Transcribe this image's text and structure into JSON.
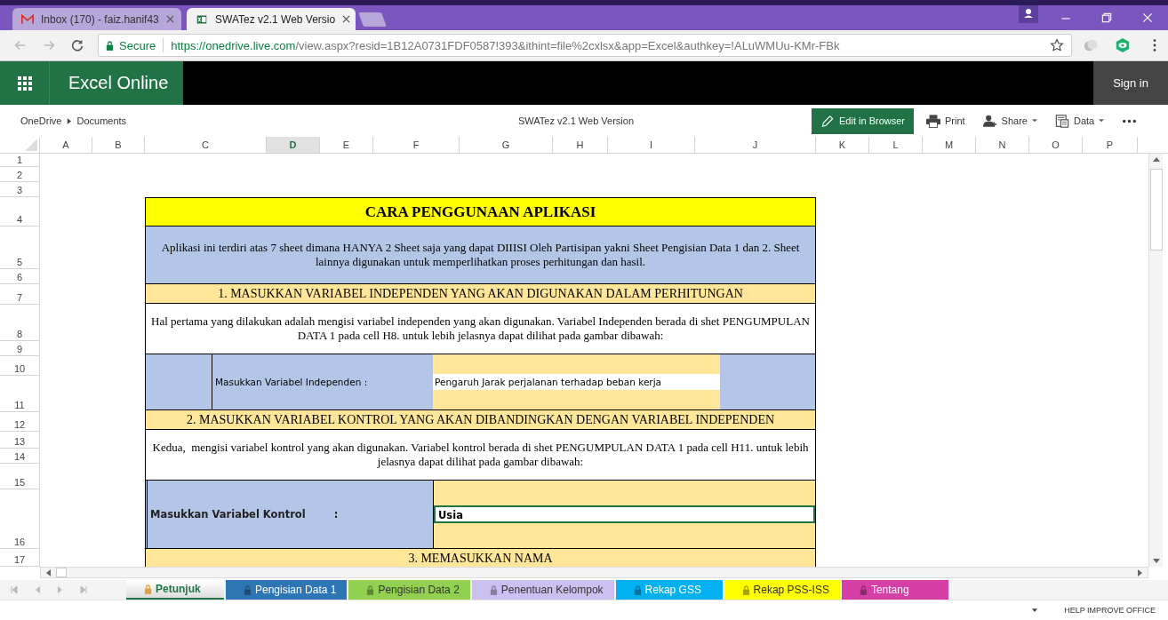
{
  "browser": {
    "tabs": [
      {
        "title": "Inbox (170) - faiz.hanif43",
        "selected": false
      },
      {
        "title": "SWATez v2.1 Web Versio",
        "selected": true
      }
    ],
    "address": {
      "secure_label": "Secure",
      "url_host": "https://onedrive.live.com",
      "url_path": "/view.aspx?resid=1B12A0731FDF0587!393&ithint=file%2cxlsx&app=Excel&authkey=!ALuWMUu-KMr-FBk"
    }
  },
  "app_bar": {
    "app_name": "Excel Online",
    "sign_in": "Sign in"
  },
  "toolbar": {
    "breadcrumb": [
      "OneDrive",
      "Documents"
    ],
    "doc_title": "SWATez v2.1 Web Version",
    "actions": [
      {
        "label": "Edit in Browser",
        "kind": "edit",
        "dropdown": false
      },
      {
        "label": "Print",
        "kind": "print",
        "dropdown": false
      },
      {
        "label": "Share",
        "kind": "share",
        "dropdown": true
      },
      {
        "label": "Data",
        "kind": "data",
        "dropdown": true
      }
    ]
  },
  "columns": [
    {
      "label": "A",
      "selected": false
    },
    {
      "label": "B",
      "selected": false
    },
    {
      "label": "C",
      "selected": false
    },
    {
      "label": "D",
      "selected": true
    },
    {
      "label": "E",
      "selected": false
    },
    {
      "label": "F",
      "selected": false
    },
    {
      "label": "G",
      "selected": false
    },
    {
      "label": "H",
      "selected": false
    },
    {
      "label": "I",
      "selected": false
    },
    {
      "label": "J",
      "selected": false
    },
    {
      "label": "K",
      "selected": false
    },
    {
      "label": "L",
      "selected": false
    },
    {
      "label": "M",
      "selected": false
    },
    {
      "label": "N",
      "selected": false
    },
    {
      "label": "O",
      "selected": false
    },
    {
      "label": "P",
      "selected": false
    }
  ],
  "rows": [
    "1",
    "2",
    "3",
    "4",
    "5",
    "6",
    "7",
    "8",
    "9",
    "10",
    "11",
    "12",
    "13",
    "14",
    "15",
    "16",
    "17"
  ],
  "sheet": {
    "blocks": [
      {
        "kind": "title",
        "text": "CARA PENGGUNAAN APLIKASI"
      },
      {
        "kind": "banner",
        "text": "Aplikasi ini terdiri atas 7 sheet dimana HANYA 2 Sheet saja yang dapat DIIISI Oleh Partisipan yakni Sheet Pengisian Data 1 dan 2. Sheet lainnya digunakan untuk memperlihatkan proses perhitungan dan hasil."
      },
      {
        "kind": "heading",
        "text": "1. MASUKKAN VARIABEL INDEPENDEN YANG AKAN DIGUNAKAN DALAM PERHITUNGAN"
      },
      {
        "kind": "note",
        "text": "Hal pertama yang dilakukan adalah mengisi variabel independen yang akan digunakan. Variabel Independen berada di shet PENGUMPULAN DATA 1 pada cell H8. untuk lebih jelasnya dapat dilihat pada gambar dibawah:"
      },
      {
        "kind": "input_inset",
        "label": "Masukkan Variabel Independen :",
        "value": "Pengaruh Jarak perjalanan terhadap beban kerja",
        "selected": false
      },
      {
        "kind": "heading",
        "text": "2. MASUKKAN VARIABEL KONTROL YANG AKAN DIBANDINGKAN DENGAN VARIABEL INDEPENDEN"
      },
      {
        "kind": "note",
        "text": "Kedua,  mengisi variabel kontrol yang akan digunakan. Variabel kontrol berada di shet PENGUMPULAN DATA 1 pada cell H11. untuk lebih jelasnya dapat dilihat pada gambar dibawah:"
      },
      {
        "kind": "input_wide",
        "label": "Masukkan Variabel Kontrol        :",
        "value": "Usia",
        "selected": true
      },
      {
        "kind": "heading",
        "text": "3. MEMASUKKAN NAMA"
      }
    ]
  },
  "sheet_tabs": [
    {
      "label": "Petunjuk",
      "color": "#e8e8e8",
      "selected": true
    },
    {
      "label": "Pengisian Data 1",
      "color": "#2e75b6",
      "selected": false
    },
    {
      "label": "Pengisian Data 2",
      "color": "#92d050",
      "selected": false
    },
    {
      "label": "Penentuan Kelompok",
      "color": "#ccc0f0",
      "selected": false
    },
    {
      "label": "Rekap GSS",
      "color": "#00b0f0",
      "selected": false
    },
    {
      "label": "Rekap PSS-ISS",
      "color": "#ffff00",
      "selected": false
    },
    {
      "label": "Tentang",
      "color": "#d63fa6",
      "selected": false
    }
  ],
  "status_bar": {
    "help": "HELP IMPROVE OFFICE"
  }
}
